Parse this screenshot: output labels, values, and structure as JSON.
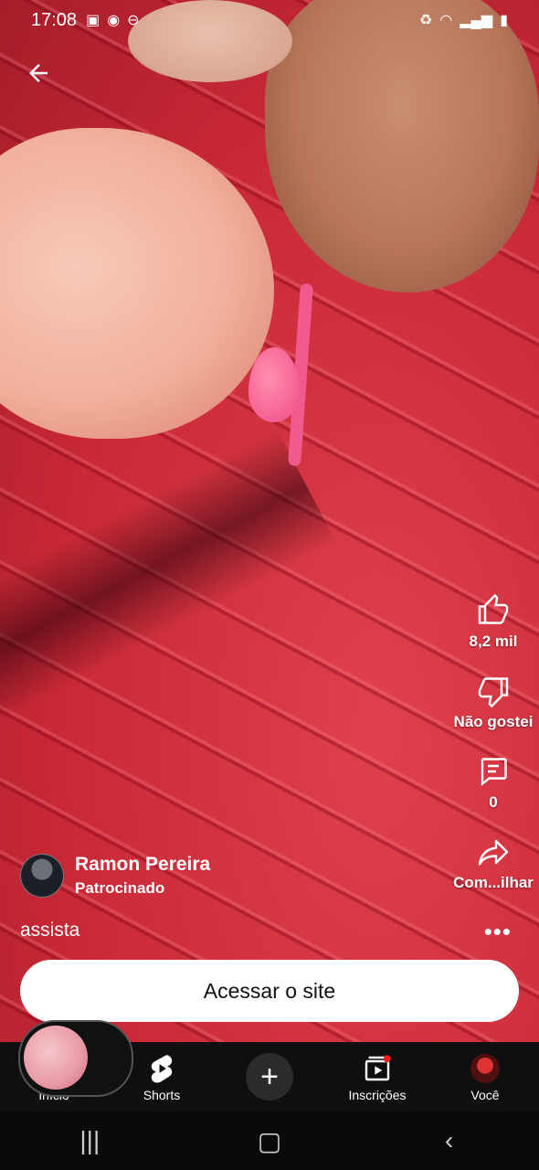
{
  "status_bar": {
    "time": "17:08"
  },
  "video": {
    "caption": "assista"
  },
  "channel": {
    "name": "Ramon Pereira",
    "tag": "Patrocinado"
  },
  "actions": {
    "like_count": "8,2 mil",
    "dislike_label": "Não gostei",
    "comments_count": "0",
    "share_label": "Com...ilhar"
  },
  "cta": {
    "label": "Acessar o site"
  },
  "bottom_nav": {
    "home": "Início",
    "shorts": "Shorts",
    "subscriptions": "Inscrições",
    "you": "Você"
  },
  "icons": {
    "back": "arrow-left-icon",
    "like": "thumbs-up-icon",
    "dislike": "thumbs-down-icon",
    "comment": "comment-icon",
    "share": "share-icon",
    "more": "more-icon",
    "create": "plus-icon"
  }
}
